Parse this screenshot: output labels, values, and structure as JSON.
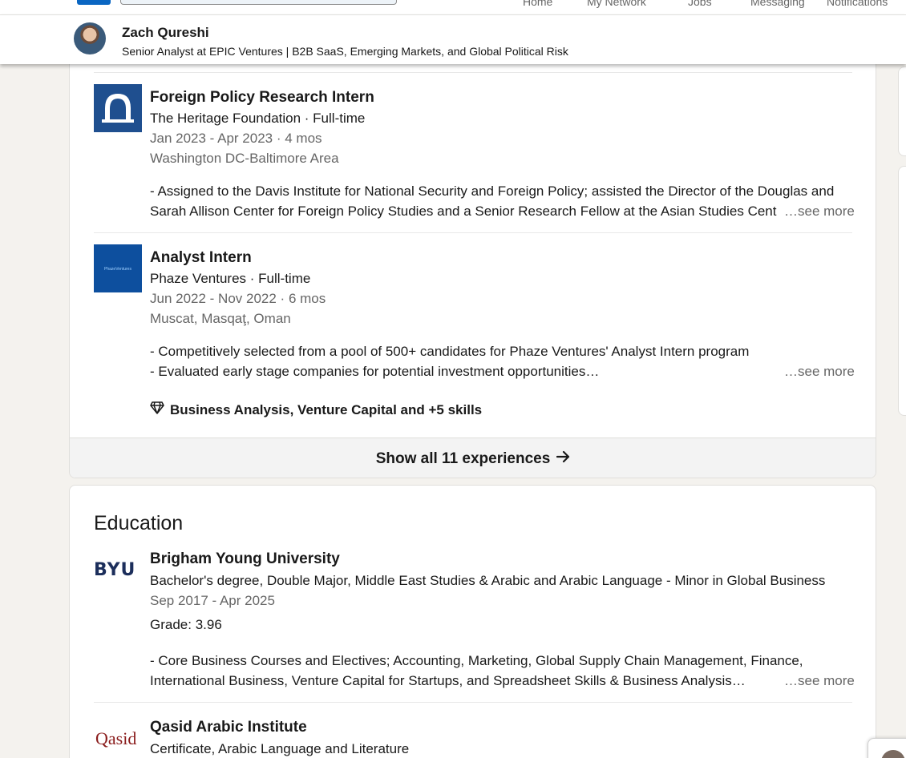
{
  "nav": {
    "links": [
      "Home",
      "My Network",
      "Jobs",
      "Messaging",
      "Notifications"
    ]
  },
  "profile_bar": {
    "name": "Zach Qureshi",
    "headline": "Senior Analyst at EPIC Ventures | B2B SaaS, Emerging Markets, and Global Political Risk"
  },
  "experience": {
    "items": [
      {
        "title": "Foreign Policy Research Intern",
        "company": "The Heritage Foundation · Full-time",
        "dates": "Jan 2023 - Apr 2023 · 4 mos",
        "location": "Washington DC-Baltimore Area",
        "desc_line1": "- Assigned to the Davis Institute for National Security and Foreign Policy; assisted the Director of the Douglas and",
        "desc_line2": "Sarah Allison Center for Foreign Policy Studies and a Senior Research Fellow at the Asian Studies Cent",
        "see_more": "…see more"
      },
      {
        "title": "Analyst Intern",
        "company": "Phaze Ventures · Full-time",
        "dates": "Jun 2022 - Nov 2022 · 6 mos",
        "location": "Muscat, Masqaţ, Oman",
        "logo_text": "PhazeVentures",
        "desc_line1": "- Competitively selected from a pool of 500+ candidates for Phaze Ventures' Analyst Intern program",
        "desc_line2": "- Evaluated early stage companies for potential investment opportunities…",
        "see_more": "…see more",
        "skills": "Business Analysis, Venture Capital and +5 skills"
      }
    ],
    "show_all": "Show all 11 experiences"
  },
  "education": {
    "title": "Education",
    "items": [
      {
        "logo_text": "BYU",
        "school": "Brigham Young University",
        "degree": "Bachelor's degree, Double Major, Middle East Studies & Arabic and Arabic Language - Minor in Global Business",
        "dates": "Sep 2017 - Apr 2025",
        "grade": "Grade: 3.96",
        "desc_line1": "- Core Business Courses and Electives; Accounting, Marketing, Global Supply Chain Management, Finance,",
        "desc_line2": "International Business, Venture Capital for Startups, and Spreadsheet Skills & Business Analysis…",
        "see_more": "…see more"
      },
      {
        "logo_text": "Qasid",
        "school": "Qasid Arabic Institute",
        "degree": "Certificate, Arabic Language and Literature"
      }
    ]
  },
  "colors": {
    "heritage_blue": "#1f4f8f",
    "phaze_blue": "#0d4f9e",
    "byu_navy": "#1c2e5b",
    "qasid_red": "#8a1c1c",
    "brand_blue": "#0a66c2"
  }
}
